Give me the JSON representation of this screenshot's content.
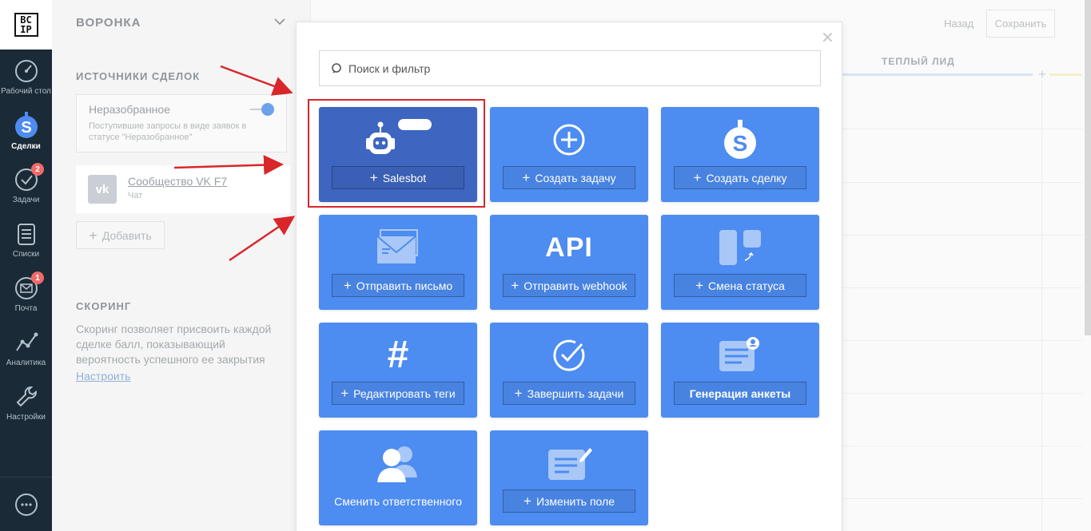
{
  "nav": {
    "logo_line1": "BC",
    "logo_line2": "IP",
    "items": [
      {
        "label": "Рабочий стол",
        "badge": ""
      },
      {
        "label": "Сделки",
        "badge": ""
      },
      {
        "label": "Задачи",
        "badge": "2"
      },
      {
        "label": "Списки",
        "badge": ""
      },
      {
        "label": "Почта",
        "badge": "1"
      },
      {
        "label": "Аналитика",
        "badge": ""
      },
      {
        "label": "Настройки",
        "badge": ""
      }
    ]
  },
  "panel": {
    "title": "ВОРОНКА",
    "sources_heading": "ИСТОЧНИКИ СДЕЛОК",
    "unsorted_title": "Неразобранное",
    "unsorted_desc": "Поступившие запросы в виде заявок в статусе \"Неразобранное\"",
    "vk_name": "Сообщество VK F7",
    "vk_type": "Чат",
    "vk_icon_text": "vk",
    "add_label": "Добавить",
    "scoring_heading": "СКОРИНГ",
    "scoring_text": "Скоринг позволяет присвоить каждой сделке балл, показывающий вероятность успешного ее закрытия",
    "scoring_link": "Настроить"
  },
  "board": {
    "back_label": "Назад",
    "save_label": "Сохранить",
    "column_title": "ТЕПЛЫЙ ЛИД"
  },
  "modal": {
    "search_placeholder": "Поиск и фильтр",
    "tiles": [
      {
        "label": "Salesbot",
        "icon": "robot-icon"
      },
      {
        "label": "Создать задачу",
        "icon": "plus-circle-icon"
      },
      {
        "label": "Создать сделку",
        "icon": "dollar-icon"
      },
      {
        "label": "Отправить письмо",
        "icon": "envelope-icon"
      },
      {
        "label": "Отправить webhook",
        "icon": "api-icon",
        "icon_text": "API"
      },
      {
        "label": "Смена статуса",
        "icon": "status-change-icon"
      },
      {
        "label": "Редактировать теги",
        "icon": "hashtag-icon"
      },
      {
        "label": "Завершить задачи",
        "icon": "check-circle-icon"
      },
      {
        "label": "Генерация анкеты",
        "icon": "form-icon"
      },
      {
        "label": "Сменить ответственного",
        "icon": "users-icon"
      },
      {
        "label": "Изменить поле",
        "icon": "edit-field-icon"
      }
    ]
  },
  "colors": {
    "tile": "#4d8cf0",
    "tile_selected": "#3e65c0",
    "highlight": "#d8262b",
    "sidebar": "#1a2a36"
  }
}
